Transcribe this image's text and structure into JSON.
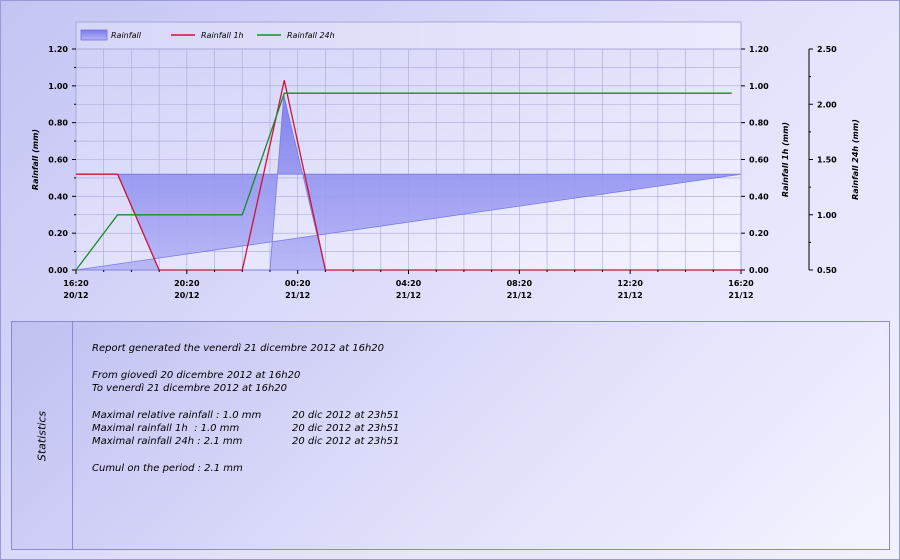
{
  "chart_data": {
    "type": "line",
    "x": [
      "2012-12-20 16:20",
      "2012-12-21 16:20"
    ],
    "x_ticks": [
      {
        "time": "16:20",
        "date": "20/12"
      },
      {
        "time": "20:20",
        "date": "20/12"
      },
      {
        "time": "00:20",
        "date": "21/12"
      },
      {
        "time": "04:20",
        "date": "21/12"
      },
      {
        "time": "08:20",
        "date": "21/12"
      },
      {
        "time": "12:20",
        "date": "21/12"
      },
      {
        "time": "16:20",
        "date": "21/12"
      }
    ],
    "ylabel": "Rainfall (mm)",
    "ylabel_right": "Rainfall 1h (mm)",
    "ylabel_right2": "Rainfall 24h (mm)",
    "ylim": [
      0,
      1.2
    ],
    "ylim_right": [
      0,
      1.2
    ],
    "ylim_right2": [
      0.5,
      2.5
    ],
    "y_ticks": [
      "0.00",
      "0.20",
      "0.40",
      "0.60",
      "0.80",
      "1.00",
      "1.20"
    ],
    "y2_ticks": [
      "0.50",
      "1.00",
      "1.50",
      "2.00",
      "2.50"
    ],
    "grid": true,
    "legend_position": "top-left",
    "series": [
      {
        "name": "Rainfall",
        "kind": "area",
        "axis": "left",
        "color": "#8c8cf0",
        "points": [
          [
            "16:20",
            0.0
          ],
          [
            "16:20",
            0.52
          ],
          [
            "17:50",
            0.52
          ],
          [
            "19:20",
            0.0
          ],
          [
            "23:20",
            0.0
          ],
          [
            "23:50",
            0.95
          ],
          [
            "01:20",
            0.0
          ],
          [
            "16:20",
            0.0
          ]
        ]
      },
      {
        "name": "Rainfall 1h",
        "kind": "line",
        "axis": "right",
        "color": "#d0103a",
        "points": [
          [
            "16:20",
            0.52
          ],
          [
            "17:50",
            0.52
          ],
          [
            "19:20",
            0.0
          ],
          [
            "22:20",
            0.0
          ],
          [
            "23:51",
            1.03
          ],
          [
            "01:20",
            0.0
          ],
          [
            "16:20",
            0.0
          ]
        ]
      },
      {
        "name": "Rainfall 24h",
        "kind": "line",
        "axis": "right2",
        "color": "#1a8a2a",
        "points": [
          [
            "16:20",
            0.5
          ],
          [
            "17:50",
            1.0
          ],
          [
            "22:20",
            1.0
          ],
          [
            "23:51",
            2.1
          ],
          [
            "16:00",
            2.1
          ]
        ]
      }
    ]
  },
  "stats": {
    "tab_label": "Statistics",
    "report_line": "Report generated the venerdì 21 dicembre 2012 at 16h20",
    "from_line": "From giovedì 20 dicembre 2012 at 16h20",
    "to_line": "To venerdì 21 dicembre 2012 at 16h20",
    "rows": [
      {
        "label": "Maximal relative rainfall : 1.0 mm",
        "date": "20 dic 2012 at 23h51"
      },
      {
        "label": "Maximal rainfall 1h  : 1.0 mm",
        "date": "20 dic 2012 at 23h51"
      },
      {
        "label": "Maximal rainfall 24h : 2.1 mm",
        "date": "20 dic 2012 at 23h51"
      }
    ],
    "cumul_line": "Cumul on the period : 2.1 mm"
  }
}
